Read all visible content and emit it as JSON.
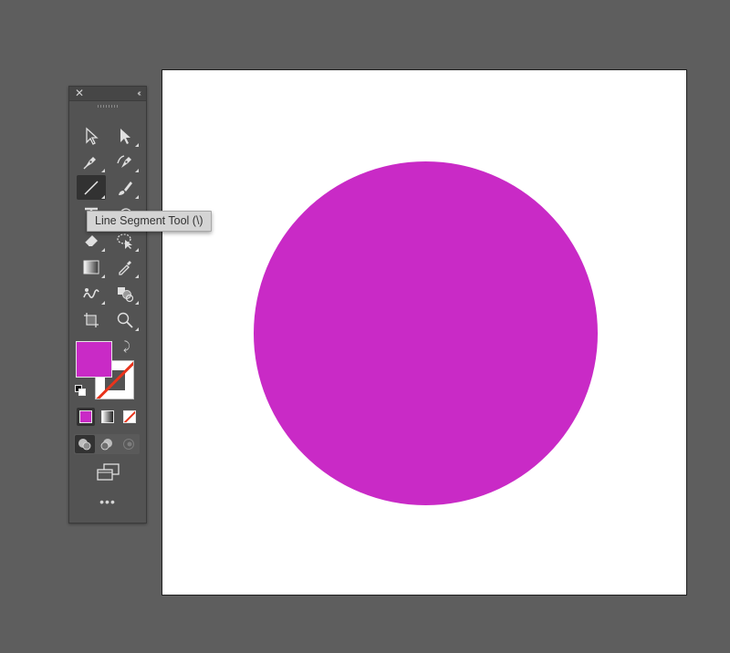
{
  "tooltip": {
    "text": "Line Segment Tool (\\)"
  },
  "colors": {
    "fill": "#c92ac6",
    "canvas": "#5e5e5e",
    "artboard": "#ffffff",
    "panel": "#535353",
    "none_slash": "#e8341c"
  },
  "artboard": {
    "shape": "ellipse",
    "fill_color": "#c92ac6"
  },
  "panel": {
    "close_icon": "close-icon",
    "collapse_icon": "collapse-icon",
    "more_label": "•••",
    "tools": [
      {
        "name": "selection-tool",
        "icon": "arrow-outline-icon",
        "active": false
      },
      {
        "name": "direct-selection-tool",
        "icon": "arrow-solid-icon",
        "active": false
      },
      {
        "name": "pen-tool",
        "icon": "pen-icon",
        "active": false
      },
      {
        "name": "curvature-tool",
        "icon": "curvature-pen-icon",
        "active": false
      },
      {
        "name": "line-segment-tool",
        "icon": "line-icon",
        "active": true
      },
      {
        "name": "paintbrush-tool",
        "icon": "brush-icon",
        "active": false
      },
      {
        "name": "type-tool",
        "icon": "type-icon",
        "active": false
      },
      {
        "name": "rotate-tool",
        "icon": "rotate-icon",
        "active": false
      },
      {
        "name": "eraser-tool",
        "icon": "eraser-icon",
        "active": false
      },
      {
        "name": "lasso-select-tool",
        "icon": "lasso-icon",
        "active": false
      },
      {
        "name": "gradient-tool",
        "icon": "gradient-icon",
        "active": false
      },
      {
        "name": "eyedropper-tool",
        "icon": "eyedropper-icon",
        "active": false
      },
      {
        "name": "puppet-warp-tool",
        "icon": "warp-icon",
        "active": false
      },
      {
        "name": "shape-builder-tool",
        "icon": "shape-builder-icon",
        "active": false
      },
      {
        "name": "artboard-tool",
        "icon": "artboard-icon",
        "active": false
      },
      {
        "name": "zoom-tool",
        "icon": "zoom-icon",
        "active": false
      }
    ]
  }
}
